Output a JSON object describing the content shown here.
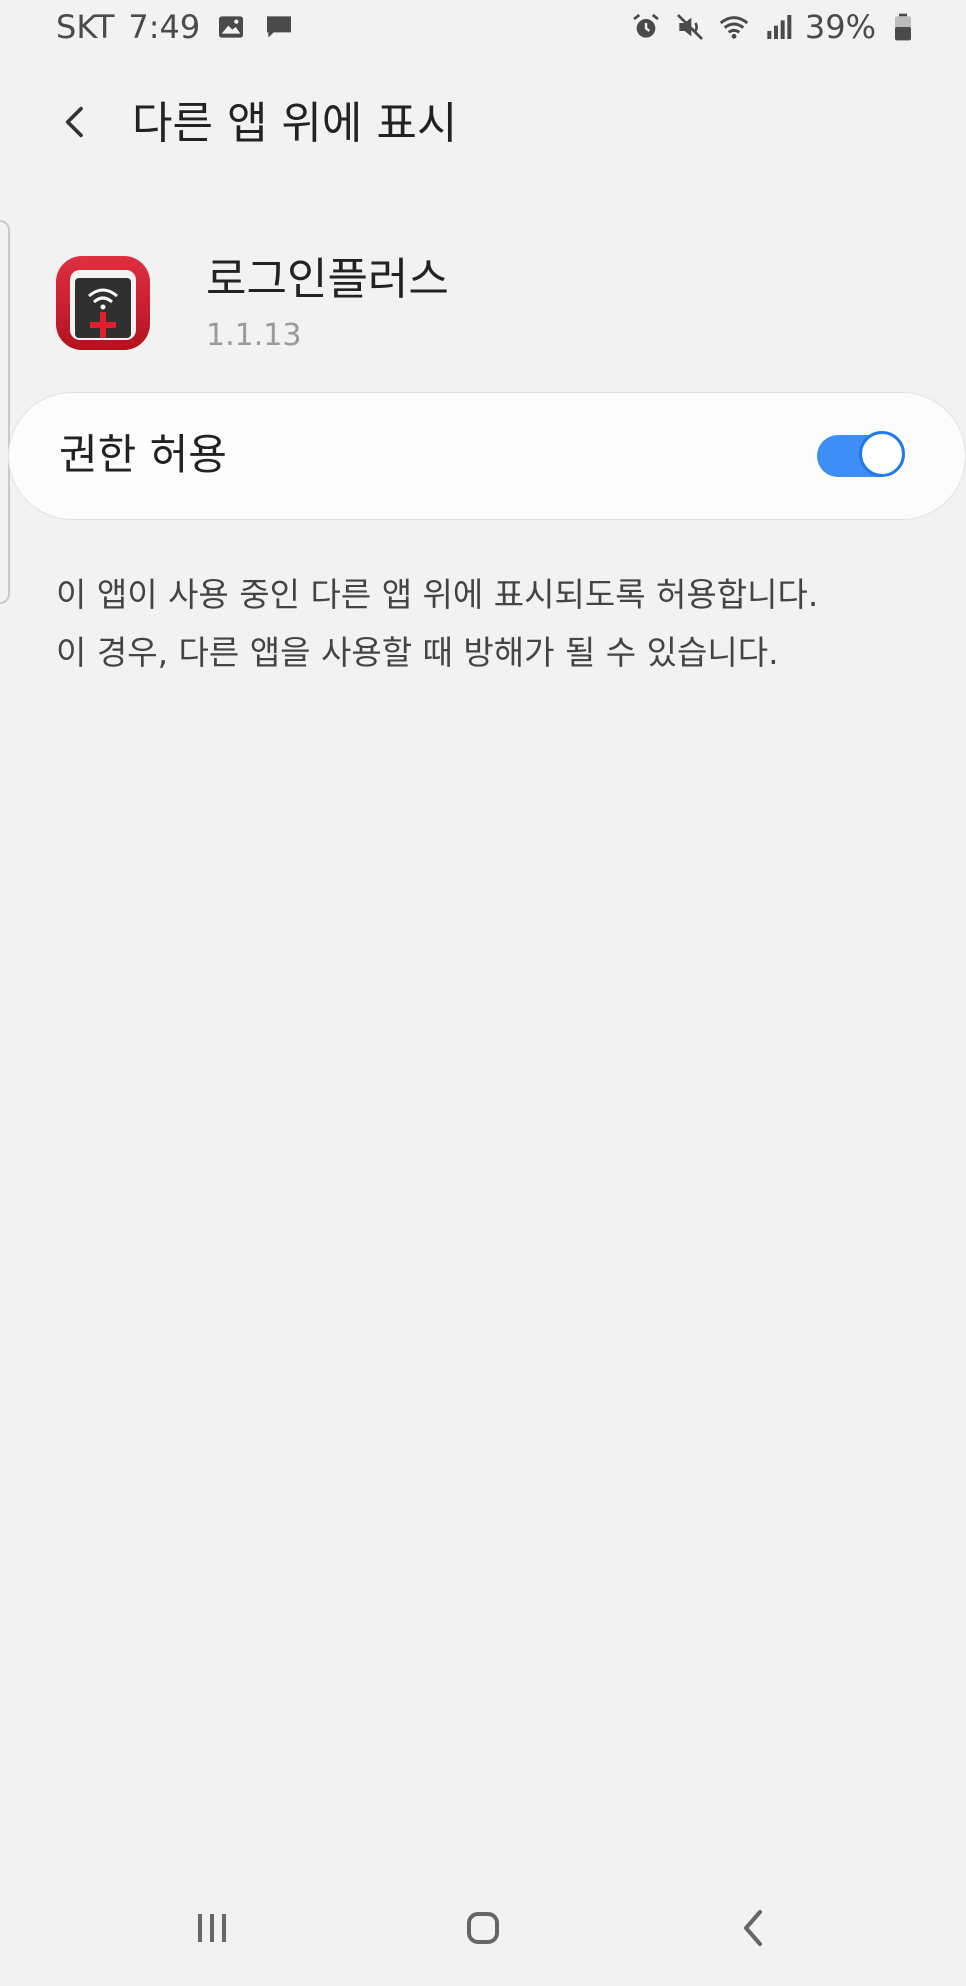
{
  "status_bar": {
    "carrier": "SKT",
    "time": "7:49",
    "battery_percent": "39%",
    "left_icons": [
      "image-icon",
      "message-icon"
    ],
    "right_icons": [
      "alarm-icon",
      "mute-icon",
      "wifi-icon",
      "signal-icon",
      "battery-icon"
    ]
  },
  "header": {
    "title": "다른 앱 위에 표시"
  },
  "app": {
    "name": "로그인플러스",
    "version": "1.1.13"
  },
  "permission": {
    "label": "권한 허용",
    "enabled": true
  },
  "description": {
    "line1": "이 앱이 사용 중인 다른 앱 위에 표시되도록 허용합니다.",
    "line2": "이 경우, 다른 앱을 사용할 때 방해가 될 수 있습니다."
  },
  "colors": {
    "accent": "#3e8ef5",
    "background": "#f2f2f2",
    "app_icon": "#c8182a"
  },
  "nav_bar": {
    "buttons": [
      "recents-icon",
      "home-icon",
      "back-icon"
    ]
  }
}
